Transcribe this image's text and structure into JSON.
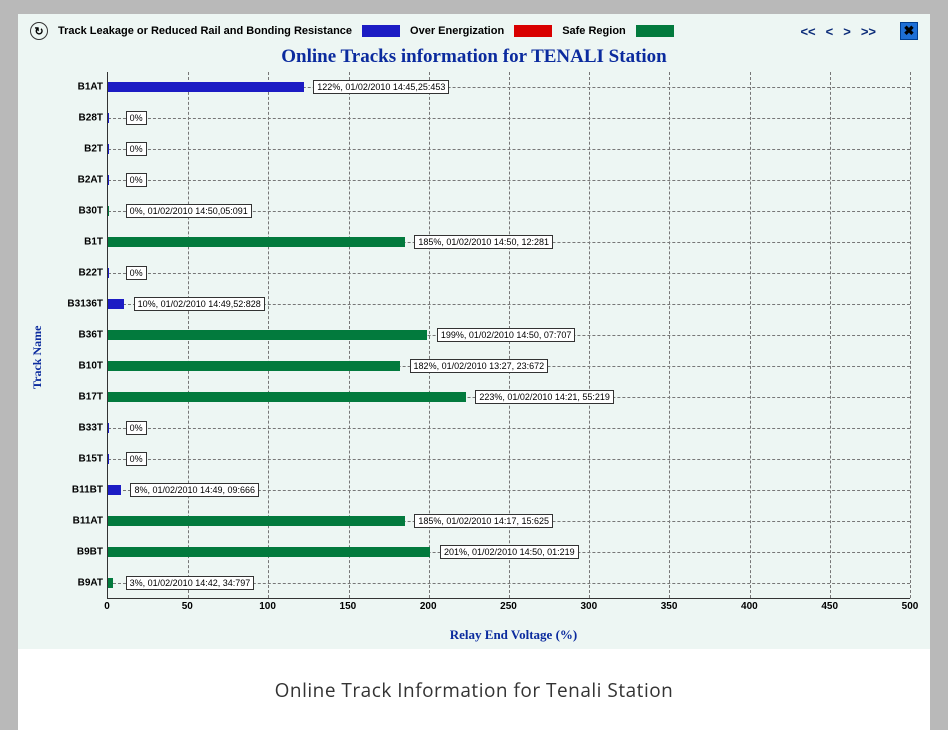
{
  "legend": {
    "refresh_icon": "↻",
    "leak_label": "Track Leakage or Reduced Rail and Bonding Resistance",
    "over_label": "Over Energization",
    "safe_label": "Safe Region",
    "nav_first": "<<",
    "nav_prev": "<",
    "nav_next": ">",
    "nav_last": ">>",
    "close_glyph": "✖"
  },
  "title": "Online Tracks information for TENALI Station",
  "ylabel": "Track Name",
  "xlabel": "Relay End Voltage (%)",
  "caption": "Online Track Information for Tenali Station",
  "chart_data": {
    "type": "bar",
    "orientation": "horizontal",
    "xlim": [
      0,
      500
    ],
    "xticks": [
      0,
      50,
      100,
      150,
      200,
      250,
      300,
      350,
      400,
      450,
      500
    ],
    "legend": [
      {
        "name": "Track Leakage or Reduced Rail and Bonding Resistance",
        "color": "#1c1cc4"
      },
      {
        "name": "Over Energization",
        "color": "#d90000"
      },
      {
        "name": "Safe Region",
        "color": "#027a3d"
      }
    ],
    "tracks": [
      {
        "name": "B1AT",
        "value": 122,
        "color": "blue",
        "label": "122%, 01/02/2010 14:45,25:453"
      },
      {
        "name": "B28T",
        "value": 0,
        "color": "blue",
        "label": "0%"
      },
      {
        "name": "B2T",
        "value": 0,
        "color": "blue",
        "label": "0%"
      },
      {
        "name": "B2AT",
        "value": 0,
        "color": "blue",
        "label": "0%"
      },
      {
        "name": "B30T",
        "value": 0,
        "color": "green",
        "label": "0%, 01/02/2010 14:50,05:091"
      },
      {
        "name": "B1T",
        "value": 185,
        "color": "green",
        "label": "185%, 01/02/2010 14:50, 12:281"
      },
      {
        "name": "B22T",
        "value": 0,
        "color": "blue",
        "label": "0%"
      },
      {
        "name": "B3136T",
        "value": 10,
        "color": "blue",
        "label": "10%, 01/02/2010 14:49,52:828"
      },
      {
        "name": "B36T",
        "value": 199,
        "color": "green",
        "label": "199%, 01/02/2010 14:50, 07:707"
      },
      {
        "name": "B10T",
        "value": 182,
        "color": "green",
        "label": "182%, 01/02/2010 13:27, 23:672"
      },
      {
        "name": "B17T",
        "value": 223,
        "color": "green",
        "label": "223%, 01/02/2010 14:21, 55:219"
      },
      {
        "name": "B33T",
        "value": 0,
        "color": "blue",
        "label": "0%"
      },
      {
        "name": "B15T",
        "value": 0,
        "color": "blue",
        "label": "0%"
      },
      {
        "name": "B11BT",
        "value": 8,
        "color": "blue",
        "label": "8%, 01/02/2010 14:49, 09:666"
      },
      {
        "name": "B11AT",
        "value": 185,
        "color": "green",
        "label": "185%, 01/02/2010 14:17, 15:625"
      },
      {
        "name": "B9BT",
        "value": 201,
        "color": "green",
        "label": "201%, 01/02/2010 14:50, 01:219"
      },
      {
        "name": "B9AT",
        "value": 3,
        "color": "green",
        "label": "3%, 01/02/2010 14:42, 34:797"
      }
    ]
  }
}
